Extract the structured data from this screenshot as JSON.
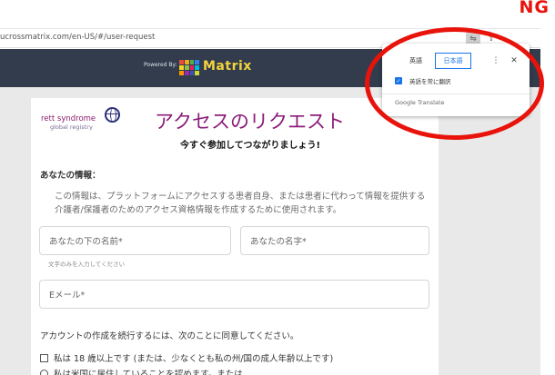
{
  "annotation": {
    "ng_label": "NG"
  },
  "browser": {
    "url": "ucrossmatrix.com/en-US/#/user-request",
    "icons": [
      "translate-icon",
      "share-icon"
    ]
  },
  "header": {
    "powered_by": "Powered By:",
    "brand": "Matrix",
    "brand_grid_colors": [
      "#e94b3c",
      "#f5a623",
      "#4caf50",
      "#2f80ed",
      "#f5d327",
      "#8bc34a",
      "#e91e63",
      "#00bcd4",
      "#ff9800",
      "#9c27b0",
      "#3f51b5",
      "#cddc39"
    ]
  },
  "page": {
    "logo_name": "rett syndrome",
    "logo_sub": "global registry",
    "title": "アクセスのリクエスト",
    "subtitle": "今すぐ参加してつながりましょう!",
    "section_heading": "あなたの情報：",
    "info_text": "この情報は、プラットフォームにアクセスする患者自身、または患者に代わって情報を提供する介護者/保護者のためのアクセス資格情報を作成するために使用されます。",
    "first_name_placeholder": "あなたの下の名前*",
    "last_name_placeholder": "あなたの名字*",
    "name_hint": "文字のみを入力してください",
    "email_placeholder": "Eメール*",
    "consent_intro": "アカウントの作成を続行するには、次のことに同意してください。",
    "age_checkbox_label": "私は 18 歳以上です (または、少なくとも私の州/国の成人年齢以上です)",
    "residence_option_label": "私は米国に居住していることを認めます。または"
  },
  "translate_popup": {
    "tab_source": "英語",
    "tab_target": "日本語",
    "always_translate": "英語を常に翻訳",
    "always_translate_checked": true,
    "brand": "Google Translate"
  },
  "colors": {
    "accent_red": "#e8130b",
    "title_purple": "#8b1b7a",
    "topbar_navy": "#323c4d",
    "google_blue": "#1a73e8"
  }
}
